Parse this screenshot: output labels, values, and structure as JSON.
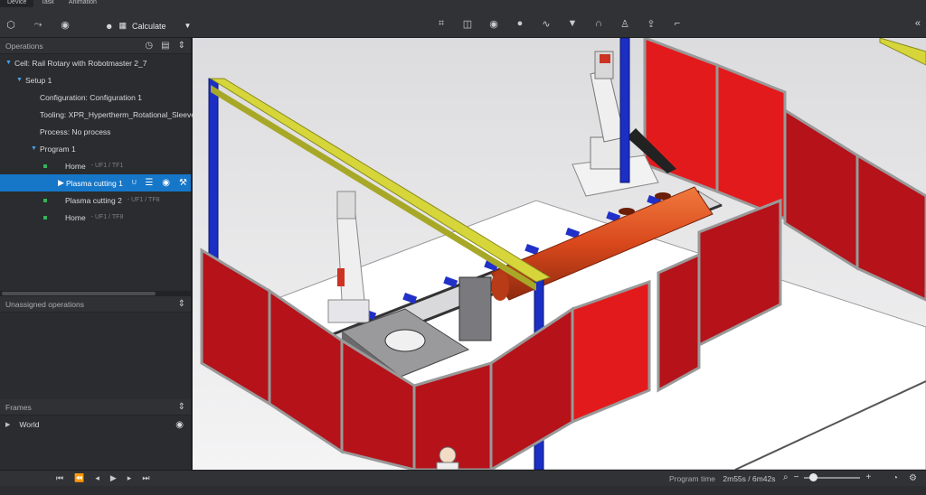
{
  "topbar": {
    "tabs": [
      "Device",
      "Task",
      "Animation"
    ],
    "calculate_label": "Calculate"
  },
  "sidebar": {
    "operations_title": "Operations",
    "tree": {
      "cell": "Cell: Rail Rotary with Robotmaster 2_7",
      "setup": "Setup 1",
      "configuration": "Configuration: Configuration 1",
      "tooling": "Tooling: XPR_Hypertherm_Rotational_Sleeve_",
      "process": "Process: No process",
      "program": "Program 1",
      "ops": [
        {
          "label": "Home",
          "sub": "- UF1 / TF1"
        },
        {
          "label": "Plasma cutting 1",
          "sub": "U"
        },
        {
          "label": "Plasma cutting 2",
          "sub": "- UF1 / TF8"
        },
        {
          "label": "Home",
          "sub": "- UF1 / TF8"
        }
      ]
    },
    "unassigned_title": "Unassigned operations",
    "frames_title": "Frames",
    "frames": [
      {
        "label": "World"
      }
    ]
  },
  "bottombar": {
    "program_time_label": "Program time",
    "program_time_value": "2m55s / 6m42s"
  },
  "colors": {
    "selection": "#1677c9",
    "panel_bg": "#2a2c2f",
    "fence_red": "#c8161d",
    "rail_blue": "#1b2fc4",
    "beam_yellow": "#d6d63a",
    "pipe_orange": "#d9481c"
  }
}
